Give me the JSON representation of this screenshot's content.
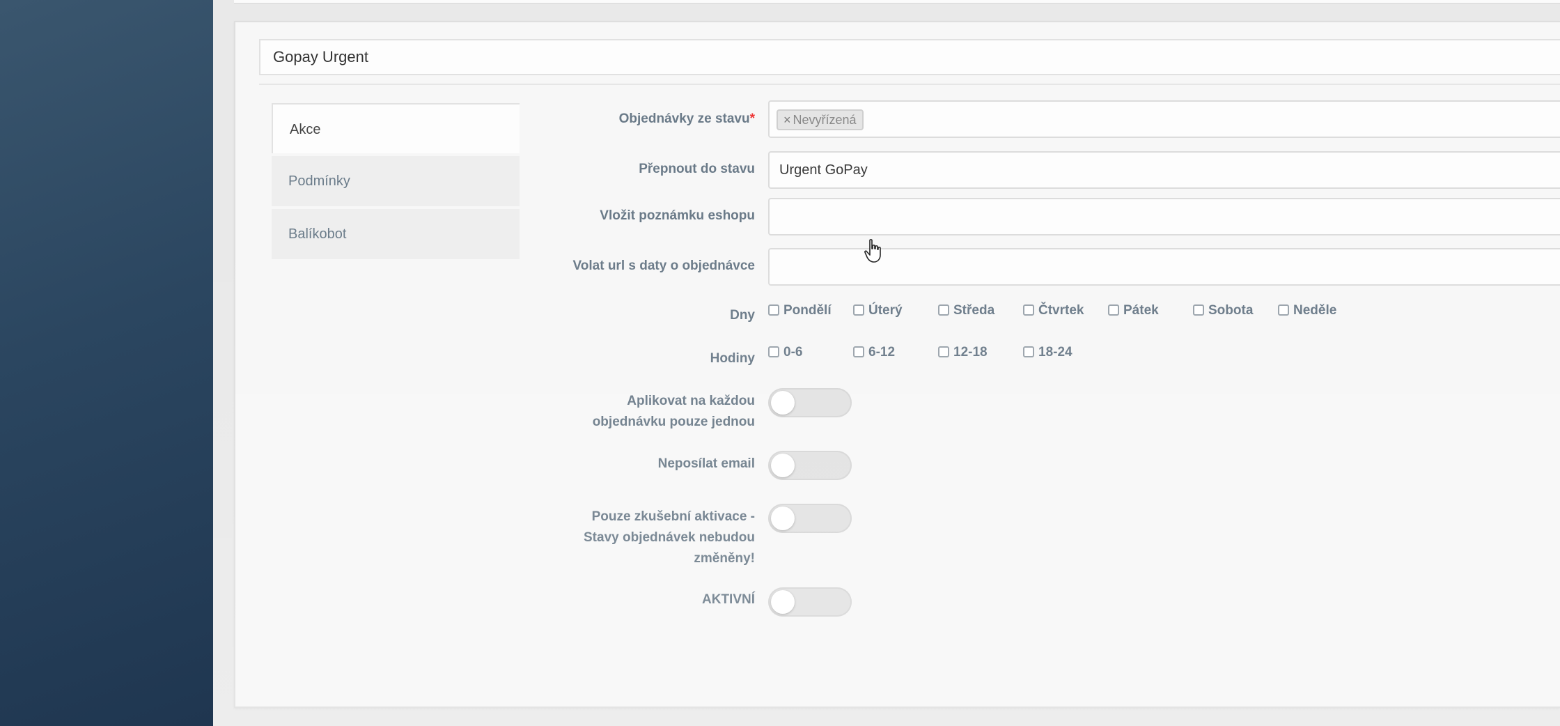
{
  "card": {
    "title": "Gopay Urgent"
  },
  "tabs": [
    {
      "label": "Akce",
      "active": true
    },
    {
      "label": "Podmínky",
      "active": false
    },
    {
      "label": "Balíkobot",
      "active": false
    }
  ],
  "form": {
    "from_status": {
      "label": "Objednávky ze stavu",
      "required_mark": "*",
      "tags": [
        "Nevyřízená"
      ],
      "tag_remove": "×"
    },
    "switch_status": {
      "label": "Přepnout do stavu",
      "value": "Urgent GoPay"
    },
    "shop_note": {
      "label": "Vložit poznámku eshopu",
      "value": ""
    },
    "call_url": {
      "label": "Volat url s daty o objednávce",
      "value": ""
    },
    "days": {
      "label": "Dny",
      "options": [
        "Pondělí",
        "Úterý",
        "Středa",
        "Čtvrtek",
        "Pátek",
        "Sobota",
        "Neděle"
      ]
    },
    "hours": {
      "label": "Hodiny",
      "options": [
        "0-6",
        "6-12",
        "12-18",
        "18-24"
      ]
    },
    "apply_once": {
      "label_line1": "Aplikovat na každou",
      "label_line2": "objednávku pouze jednou",
      "on": false
    },
    "no_email": {
      "label": "Neposílat email",
      "on": false
    },
    "test_activation": {
      "label_line1": "Pouze zkušební aktivace -",
      "label_line2": "Stavy objednávek nebudou",
      "label_line3": "změněny!",
      "on": false
    },
    "active": {
      "label": "AKTIVNÍ",
      "on": false
    }
  },
  "colors": {
    "sidebar": "#2b4660",
    "label": "#6a7a88",
    "required": "#e33333",
    "toggle_off": "#e2e2e2"
  }
}
